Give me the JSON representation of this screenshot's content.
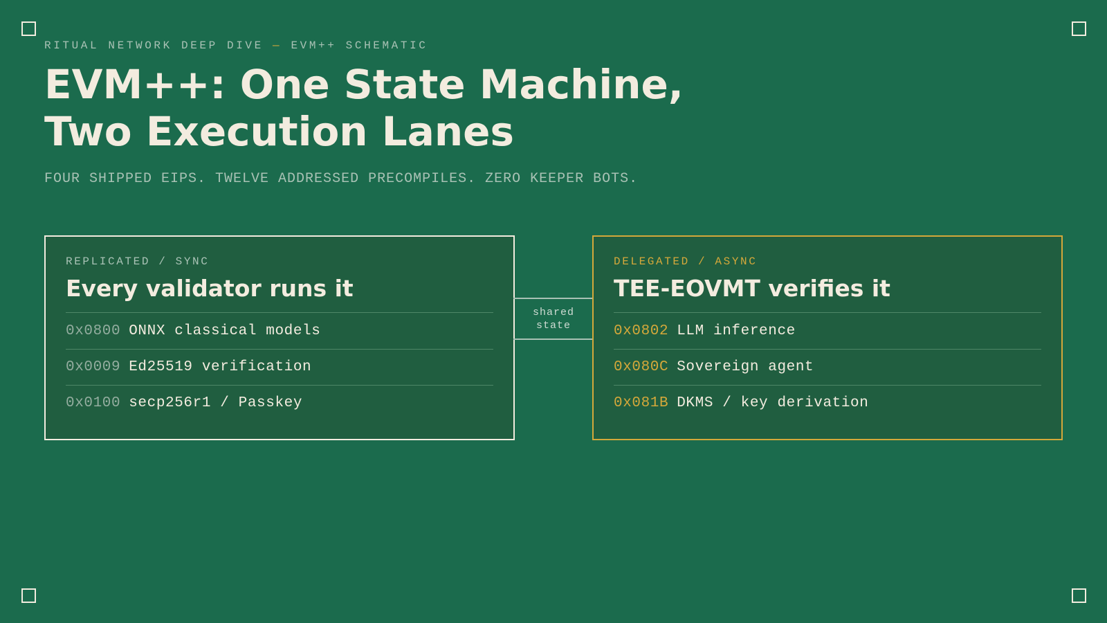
{
  "eyebrow": {
    "left": "RITUAL NETWORK DEEP DIVE",
    "dash": "—",
    "right": "EVM++ SCHEMATIC"
  },
  "title": {
    "line1": "EVM++: One State Machine,",
    "line2": "Two Execution Lanes"
  },
  "subtitle": "FOUR SHIPPED EIPS. TWELVE ADDRESSED PRECOMPILES. ZERO KEEPER BOTS.",
  "lanes": {
    "left": {
      "kicker": "REPLICATED / SYNC",
      "title": "Every validator runs it",
      "rows": [
        {
          "addr": "0x0800",
          "label": "ONNX classical models"
        },
        {
          "addr": "0x0009",
          "label": "Ed25519 verification"
        },
        {
          "addr": "0x0100",
          "label": "secp256r1 / Passkey"
        }
      ]
    },
    "right": {
      "kicker": "DELEGATED / ASYNC",
      "title": "TEE-EOVMT verifies it",
      "rows": [
        {
          "addr": "0x0802",
          "label": "LLM inference"
        },
        {
          "addr": "0x080C",
          "label": "Sovereign agent"
        },
        {
          "addr": "0x081B",
          "label": "DKMS / key derivation"
        }
      ]
    }
  },
  "connector": {
    "line1": "shared",
    "line2": "state"
  },
  "colors": {
    "background": "#1b6b4d",
    "panel": "#205e40",
    "cream": "#f3ecdf",
    "accent": "#d4a83a",
    "muted": "#a9c2b5"
  }
}
